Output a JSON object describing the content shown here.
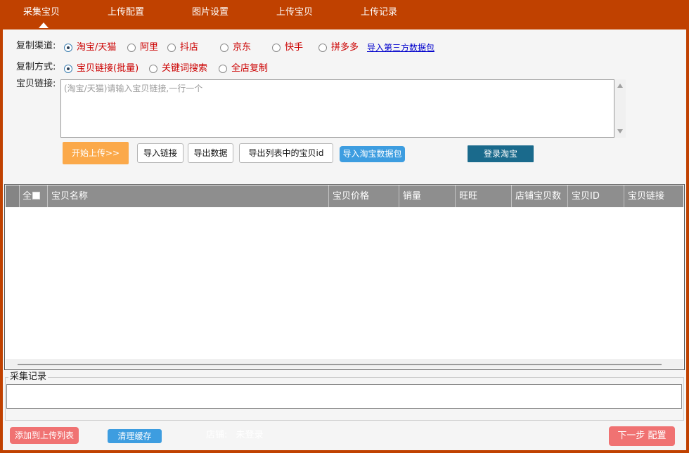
{
  "tabs": [
    {
      "label": "采集宝贝",
      "active": true
    },
    {
      "label": "上传配置",
      "active": false
    },
    {
      "label": "图片设置",
      "active": false
    },
    {
      "label": "上传宝贝",
      "active": false
    },
    {
      "label": "上传记录",
      "active": false
    }
  ],
  "channel": {
    "label": "复制渠道:",
    "options": [
      "淘宝/天猫",
      "阿里",
      "抖店",
      "京东",
      "快手",
      "拼多多"
    ],
    "selected": "淘宝/天猫",
    "import_link": "导入第三方数据包"
  },
  "mode": {
    "label": "复制方式:",
    "options": [
      "宝贝链接(批量)",
      "关键词搜索",
      "全店复制"
    ],
    "selected": "宝贝链接(批量)"
  },
  "links": {
    "label": "宝贝链接:",
    "placeholder": "(淘宝/天猫)请输入宝贝链接,一行一个",
    "value": ""
  },
  "actions": {
    "start": "开始上传>>",
    "import_links": "导入链接",
    "export_data": "导出数据",
    "export_ids": "导出列表中的宝贝id",
    "import_taobao_pack": "导入淘宝数据包",
    "login_taobao": "登录淘宝"
  },
  "table": {
    "select_all": "全",
    "columns": [
      "宝贝名称",
      "宝贝价格",
      "销量",
      "旺旺",
      "店铺宝贝数",
      "宝贝ID",
      "宝贝链接"
    ],
    "rows": []
  },
  "log": {
    "label": "采集记录",
    "value": ""
  },
  "footer": {
    "add_to_upload": "添加到上传列表",
    "clear_cache": "清理缓存",
    "shop_label": "店铺:",
    "shop_status": "未登录",
    "next": "下一步 配置"
  },
  "colors": {
    "top_bar": "#c04100",
    "start_orange": "#fba94a",
    "action_blue": "#3d9de0",
    "login_blue": "#1a6a8c",
    "pink": "#f07272",
    "option_red": "#cc0000",
    "link_blue": "#0000cc"
  }
}
